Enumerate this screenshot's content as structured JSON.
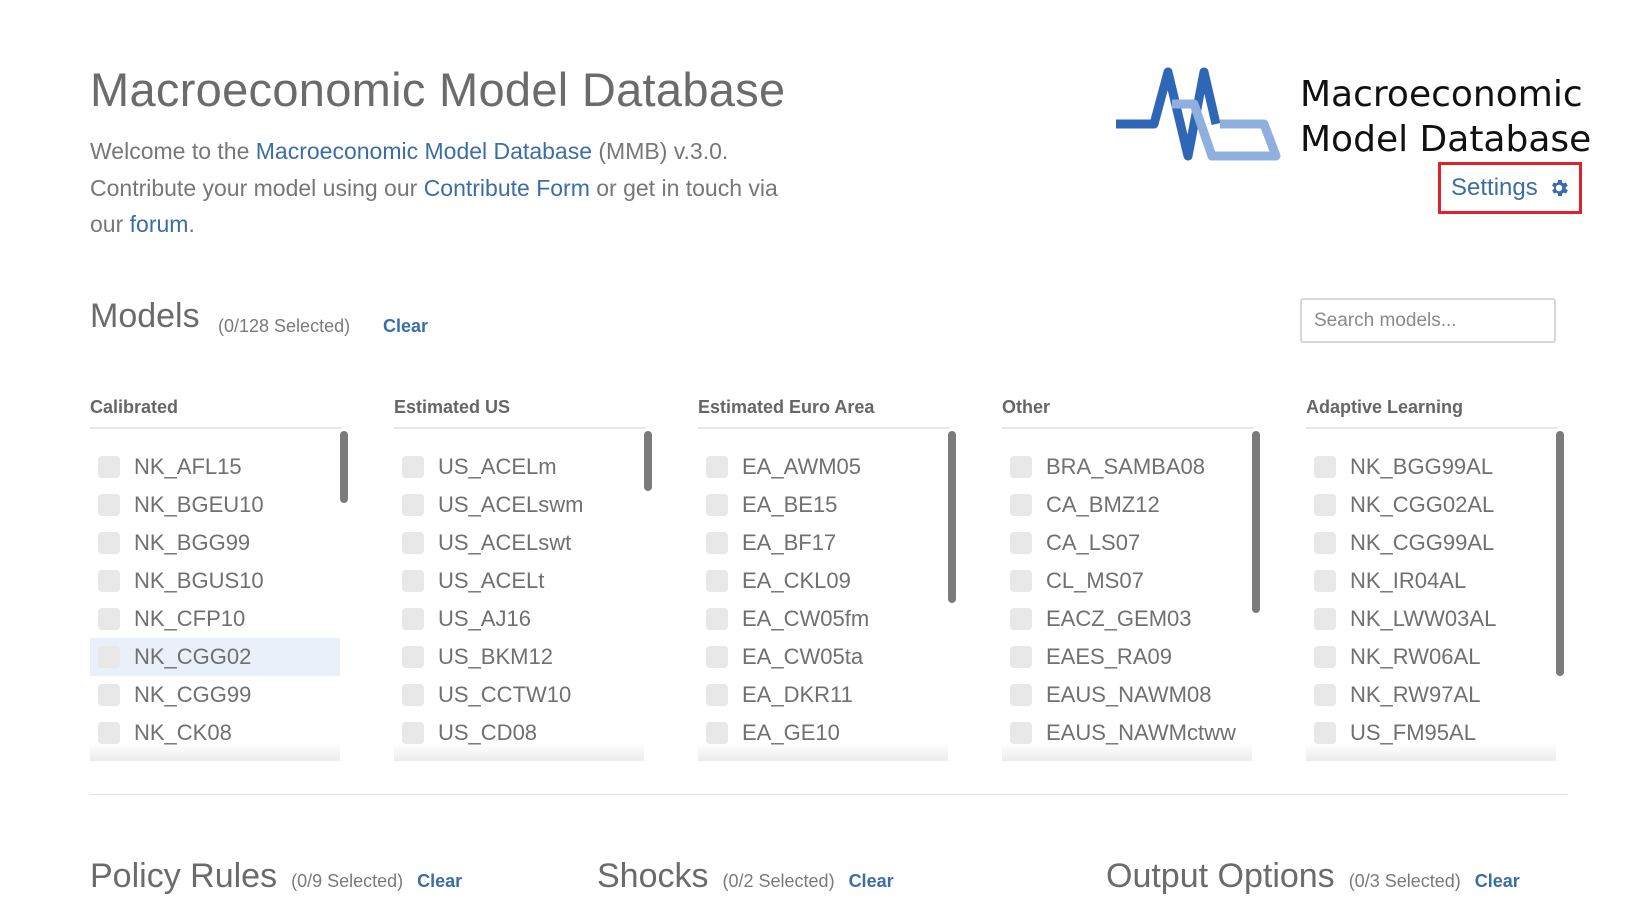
{
  "header": {
    "title": "Macroeconomic Model Database",
    "intro": {
      "p1": "Welcome to the ",
      "link1": "Macroeconomic Model Database",
      "p2": " (MMB) v.3.0. Contribute your model using our ",
      "link2": "Contribute Form",
      "p3": " or get in touch via our ",
      "link3": "forum",
      "p4": "."
    },
    "logo_line1": "Macroeconomic",
    "logo_line2": "Model Database",
    "settings_label": "Settings",
    "settings_icon": "gear-icon"
  },
  "models": {
    "title": "Models",
    "selected": "(0/128 Selected)",
    "clear": "Clear",
    "search_placeholder": "Search models...",
    "columns": [
      {
        "title": "Calibrated",
        "items": [
          "NK_AFL15",
          "NK_BGEU10",
          "NK_BGG99",
          "NK_BGUS10",
          "NK_CFP10",
          "NK_CGG02",
          "NK_CGG99",
          "NK_CK08"
        ]
      },
      {
        "title": "Estimated US",
        "items": [
          "US_ACELm",
          "US_ACELswm",
          "US_ACELswt",
          "US_ACELt",
          "US_AJ16",
          "US_BKM12",
          "US_CCTW10",
          "US_CD08"
        ]
      },
      {
        "title": "Estimated Euro Area",
        "items": [
          "EA_AWM05",
          "EA_BE15",
          "EA_BF17",
          "EA_CKL09",
          "EA_CW05fm",
          "EA_CW05ta",
          "EA_DKR11",
          "EA_GE10"
        ]
      },
      {
        "title": "Other",
        "items": [
          "BRA_SAMBA08",
          "CA_BMZ12",
          "CA_LS07",
          "CL_MS07",
          "EACZ_GEM03",
          "EAES_RA09",
          "EAUS_NAWM08",
          "EAUS_NAWMctww"
        ]
      },
      {
        "title": "Adaptive Learning",
        "items": [
          "NK_BGG99AL",
          "NK_CGG02AL",
          "NK_CGG99AL",
          "NK_IR04AL",
          "NK_LWW03AL",
          "NK_RW06AL",
          "NK_RW97AL",
          "US_FM95AL"
        ]
      }
    ]
  },
  "policy_rules": {
    "title": "Policy Rules",
    "selected": "(0/9 Selected)",
    "clear": "Clear"
  },
  "shocks": {
    "title": "Shocks",
    "selected": "(0/2 Selected)",
    "clear": "Clear"
  },
  "output_options": {
    "title": "Output Options",
    "selected": "(0/3 Selected)",
    "clear": "Clear"
  }
}
